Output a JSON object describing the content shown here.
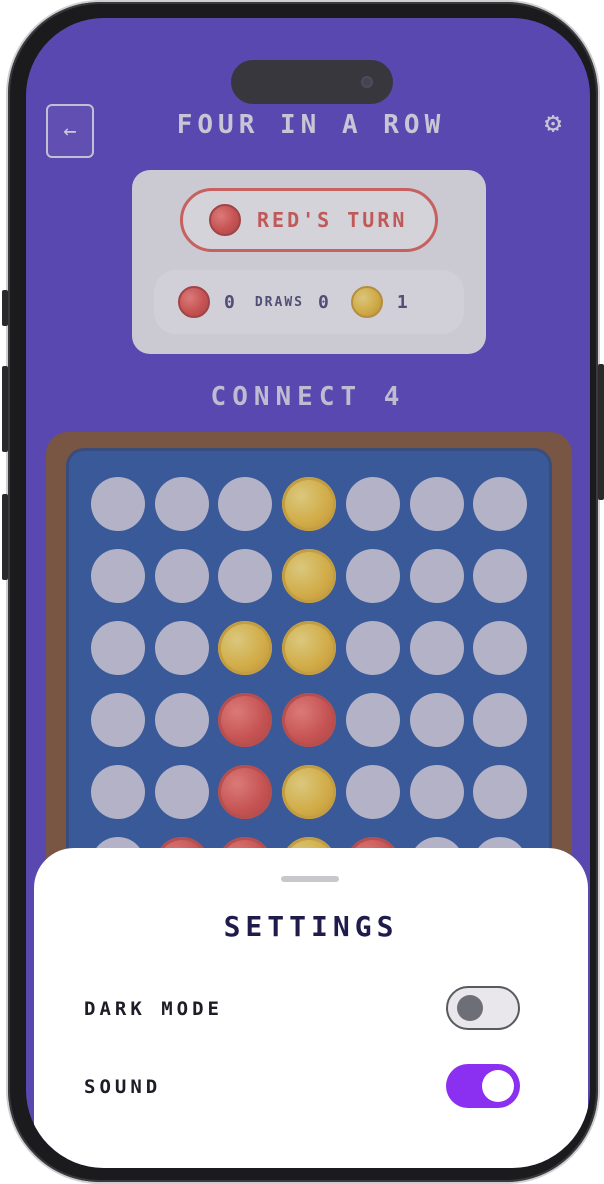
{
  "header": {
    "title": "FOUR IN A ROW",
    "back_icon": "arrow-left-icon",
    "settings_icon": "gear-icon"
  },
  "status": {
    "turn_text": "RED'S TURN",
    "turn_color": "#e0453e",
    "red_score": "0",
    "draws_label": "DRAWS",
    "draws_score": "0",
    "yellow_score": "1"
  },
  "game_label": "CONNECT 4",
  "board": {
    "columns": 7,
    "rows_visible": 5,
    "grid": [
      [
        "empty",
        "empty",
        "empty",
        "yellow",
        "empty",
        "empty",
        "empty"
      ],
      [
        "empty",
        "empty",
        "empty",
        "yellow",
        "empty",
        "empty",
        "empty"
      ],
      [
        "empty",
        "empty",
        "yellow",
        "yellow",
        "empty",
        "empty",
        "empty"
      ],
      [
        "empty",
        "empty",
        "red",
        "red",
        "empty",
        "empty",
        "empty"
      ],
      [
        "empty",
        "empty",
        "red",
        "yellow",
        "empty",
        "empty",
        "empty"
      ]
    ]
  },
  "settings_sheet": {
    "title": "SETTINGS",
    "dark_mode_label": "DARK MODE",
    "dark_mode_on": false,
    "sound_label": "SOUND",
    "sound_on": true,
    "accent": "#8b2ff0"
  }
}
